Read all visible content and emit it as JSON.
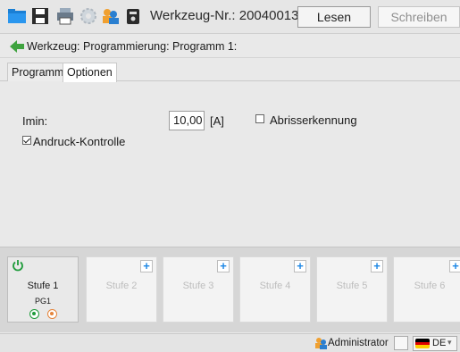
{
  "toolbar": {
    "title": "Werkzeug-Nr.: 20040013",
    "read_label": "Lesen",
    "write_label": "Schreiben"
  },
  "breadcrumb": {
    "text": "Werkzeug: Programmierung: Programm 1:"
  },
  "tabs": [
    {
      "label": "Programm",
      "active": false
    },
    {
      "label": "Optionen",
      "active": true
    }
  ],
  "options": {
    "imin_label": "Imin:",
    "imin_value": "10,00",
    "imin_unit": "[A]",
    "abriss_label": "Abrisserkennung",
    "abriss_checked": false,
    "andruck_label": "Andruck-Kontrolle",
    "andruck_checked": true
  },
  "stages": [
    {
      "label": "Stufe 1",
      "sub": "PG1",
      "active": true
    },
    {
      "label": "Stufe 2",
      "active": false
    },
    {
      "label": "Stufe 3",
      "active": false
    },
    {
      "label": "Stufe 4",
      "active": false
    },
    {
      "label": "Stufe 5",
      "active": false
    },
    {
      "label": "Stufe 6",
      "active": false
    }
  ],
  "status": {
    "user": "Administrator",
    "language": "DE"
  },
  "colors": {
    "accent_blue": "#1e88e5",
    "active_green": "#1e9b3a",
    "orange": "#e5843a"
  }
}
